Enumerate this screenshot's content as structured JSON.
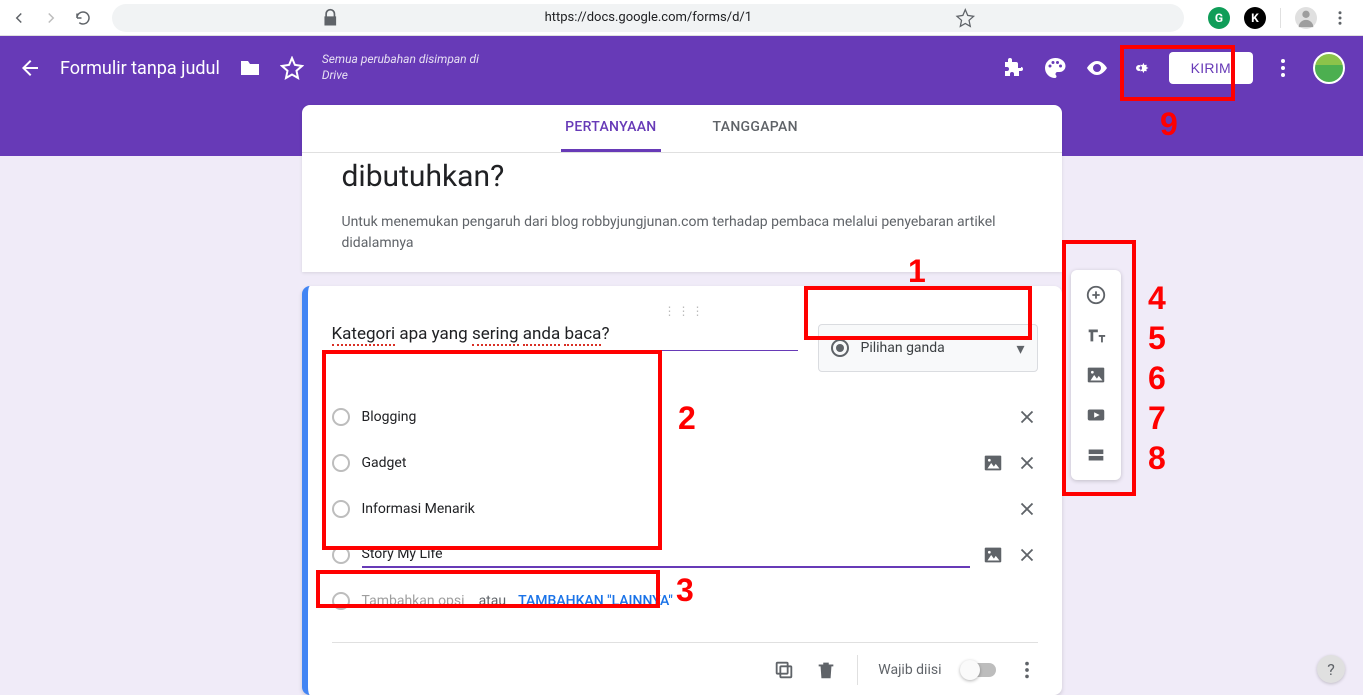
{
  "browser": {
    "url": "https://docs.google.com/forms/d/17zuriDXsG6IOB0ya29MIspVi_hBUjsjx6LhbNEgb68I/edit"
  },
  "header": {
    "title": "Formulir tanpa judul",
    "save_status": "Semua perubahan disimpan di Drive",
    "send_label": "KIRIM"
  },
  "tabs": {
    "questions": "PERTANYAAN",
    "responses": "TANGGAPAN"
  },
  "form": {
    "title": "dibutuhkan?",
    "description": "Untuk menemukan pengaruh dari blog robbyjungjunan.com terhadap pembaca melalui penyebaran artikel didalamnya"
  },
  "question": {
    "title_parts": [
      "Kategori",
      " apa yang ",
      "sering",
      " ",
      "anda",
      " ",
      "baca",
      "?"
    ],
    "type_label": "Pilihan ganda",
    "options": [
      {
        "text": "Blogging",
        "image_btn": false,
        "remove_btn": true
      },
      {
        "text": "Gadget",
        "image_btn": true,
        "remove_btn": true
      },
      {
        "text": "Informasi Menarik",
        "image_btn": false,
        "remove_btn": true
      },
      {
        "text": "Story My Life",
        "image_btn": true,
        "remove_btn": true,
        "editing": true
      }
    ],
    "add_option_placeholder": "Tambahkan opsi",
    "add_separator": "atau",
    "add_other_label": "TAMBAHKAN \"LAINNYA\"",
    "required_label": "Wajib diisi",
    "required": false
  },
  "side_toolbar": {
    "items": [
      "add-question",
      "add-title",
      "add-image",
      "add-video",
      "add-section"
    ]
  },
  "annotations": {
    "numbers": [
      "1",
      "2",
      "3",
      "4",
      "5",
      "6",
      "7",
      "8",
      "9"
    ]
  },
  "help": "?"
}
